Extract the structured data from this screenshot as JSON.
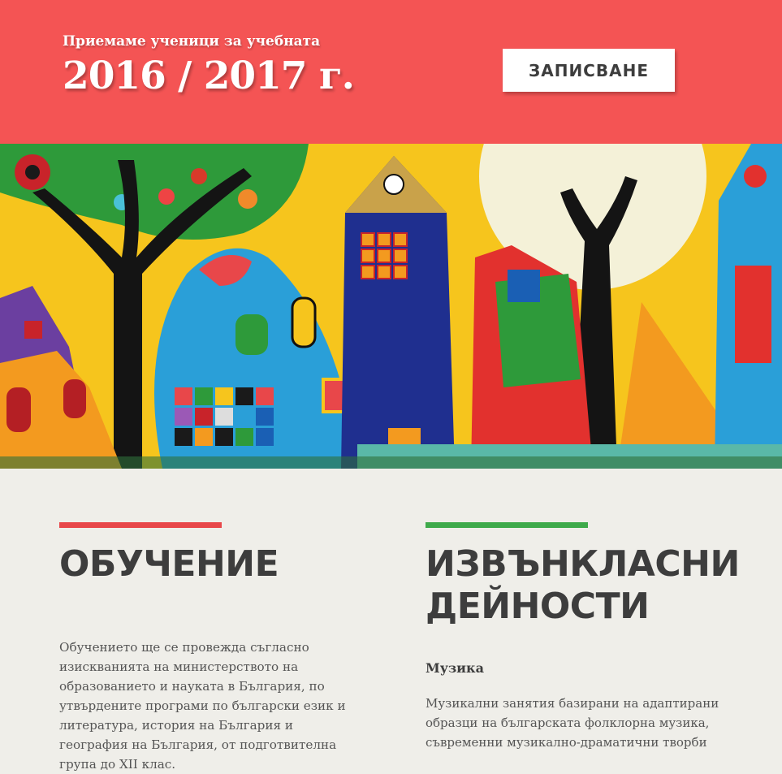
{
  "banner": {
    "subtitle": "Приемаме ученици за учебната",
    "year": "2016 / 2017 г.",
    "enroll_button": "ЗАПИСВАНЕ"
  },
  "hero": {
    "image": "children-painting-colorful-houses-and-trees"
  },
  "training": {
    "heading": "ОБУЧЕНИЕ",
    "text": "Обучението ще се провежда съгласно изискванията на министерството на образованието и науката в България, по утвърдените програми по български език и литература, история на България и география на България, от подготвителна група до XII клас."
  },
  "extracurricular": {
    "heading": "ИЗВЪНКЛАСНИ ДЕЙНОСТИ",
    "music_title": "Музика",
    "music_text": "Музикални занятия базирани на адаптирани образци на българската фолклорна музика, съвременни музикално-драматични творби"
  },
  "colors": {
    "banner": "#f45454",
    "accent_red": "#e8474a",
    "accent_green": "#3faa4b",
    "background": "#efeee9"
  }
}
